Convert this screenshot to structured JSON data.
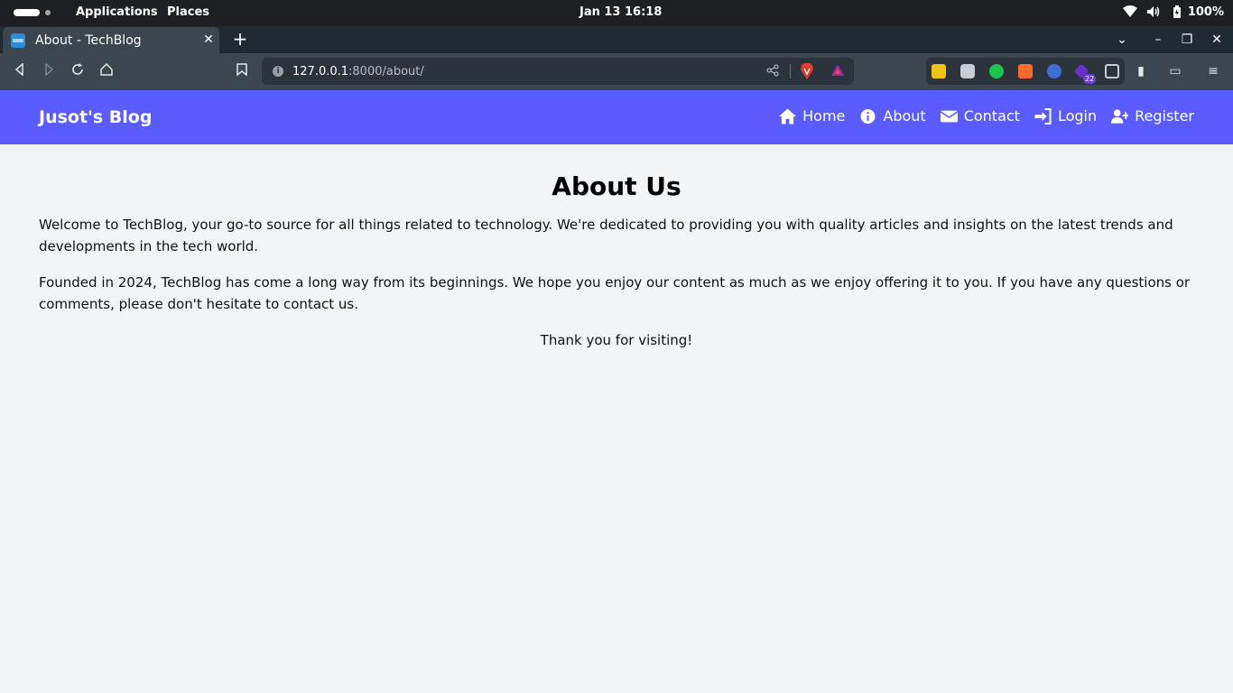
{
  "system_bar": {
    "menu_applications": "Applications",
    "menu_places": "Places",
    "clock": "Jan 13  16:18",
    "battery": "100%",
    "icons": [
      "wifi-icon",
      "volume-icon",
      "battery-icon"
    ]
  },
  "browser": {
    "tab_title": "About - TechBlog",
    "url_host": "127.0.0.1",
    "url_path": ":8000/about/",
    "extension_badge": "22",
    "accent_brave": "#e33b2f",
    "accent_bat": "#a52aa5"
  },
  "site": {
    "brand": "Jusot's Blog",
    "nav_color": "#5a5cff",
    "nav": [
      {
        "label": "Home",
        "icon": "home-icon"
      },
      {
        "label": "About",
        "icon": "info-icon"
      },
      {
        "label": "Contact",
        "icon": "envelope-icon"
      },
      {
        "label": "Login",
        "icon": "login-icon"
      },
      {
        "label": "Register",
        "icon": "user-plus-icon"
      }
    ]
  },
  "page": {
    "heading": "About Us",
    "paragraph1": "Welcome to TechBlog, your go-to source for all things related to technology. We're dedicated to providing you with quality articles and insights on the latest trends and developments in the tech world.",
    "paragraph2": "Founded in 2024, TechBlog has come a long way from its beginnings. We hope you enjoy our content as much as we enjoy offering it to you. If you have any questions or comments, please don't hesitate to contact us.",
    "thanks": "Thank you for visiting!"
  }
}
